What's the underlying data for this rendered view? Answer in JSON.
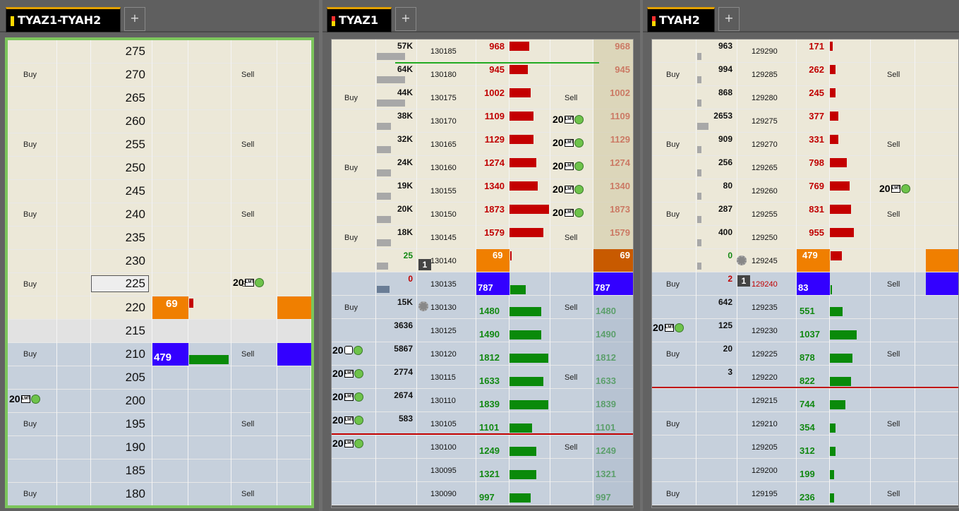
{
  "panels": [
    {
      "tab": "TYAZ1-TYAH2",
      "plus": "+"
    },
    {
      "tab": "TYAZ1",
      "plus": "+"
    },
    {
      "tab": "TYAH2",
      "plus": "+"
    }
  ],
  "labels": {
    "buy": "Buy",
    "sell": "Sell"
  },
  "p1": {
    "prices": [
      "275",
      "270",
      "265",
      "260",
      "255",
      "250",
      "245",
      "240",
      "235",
      "230",
      "225",
      "220",
      "215",
      "210",
      "205",
      "200",
      "195",
      "190",
      "185",
      "180"
    ],
    "ask_qty": "69",
    "bid_qty": "479",
    "order1": "20",
    "order2": "20"
  },
  "p2": {
    "prices": [
      "130185",
      "130180",
      "130175",
      "130170",
      "130165",
      "130160",
      "130155",
      "130150",
      "130145",
      "130140",
      "130135",
      "130130",
      "130125",
      "130120",
      "130115",
      "130110",
      "130105",
      "130100",
      "130095",
      "130090"
    ],
    "vols": [
      "57K",
      "64K",
      "44K",
      "38K",
      "32K",
      "24K",
      "19K",
      "20K",
      "18K",
      "25",
      "0",
      "15K",
      "3636",
      "5867",
      "2774",
      "2674",
      "583",
      "",
      "",
      ""
    ],
    "qtys": [
      "968",
      "945",
      "1002",
      "1109",
      "1129",
      "1274",
      "1340",
      "1873",
      "1579",
      "69",
      "787",
      "1480",
      "1490",
      "1812",
      "1633",
      "1839",
      "1101",
      "1249",
      "1321",
      "997"
    ],
    "sell_orders": [
      "",
      "",
      "",
      "20",
      "20",
      "20",
      "20",
      "20",
      "",
      "",
      "",
      "",
      "",
      "",
      "",
      "",
      "",
      "",
      "",
      ""
    ],
    "buy_orders": [
      "",
      "",
      "",
      "",
      "",
      "",
      "",
      "",
      "",
      "",
      "",
      "",
      "",
      "20",
      "20",
      "20",
      "20",
      "20",
      "",
      ""
    ],
    "position": "1"
  },
  "p3": {
    "prices": [
      "129290",
      "129285",
      "129280",
      "129275",
      "129270",
      "129265",
      "129260",
      "129255",
      "129250",
      "129245",
      "129240",
      "129235",
      "129230",
      "129225",
      "129220",
      "129215",
      "129210",
      "129205",
      "129200",
      "129195"
    ],
    "vols": [
      "963",
      "994",
      "868",
      "2653",
      "909",
      "256",
      "80",
      "287",
      "400",
      "0",
      "2",
      "642",
      "125",
      "20",
      "3",
      "",
      "",
      "",
      "",
      ""
    ],
    "qtys": [
      "171",
      "262",
      "245",
      "377",
      "331",
      "798",
      "769",
      "831",
      "955",
      "479",
      "83",
      "551",
      "1037",
      "878",
      "822",
      "744",
      "354",
      "312",
      "199",
      "236"
    ],
    "sell_order": "20",
    "buy_order": "20",
    "position": "1"
  },
  "colors": {
    "ask": "#ece8d8",
    "bid": "#c6d0dc",
    "orange": "#f07f00",
    "blue": "#3300ff",
    "red": "#c40000",
    "green": "#0a8a0a"
  }
}
